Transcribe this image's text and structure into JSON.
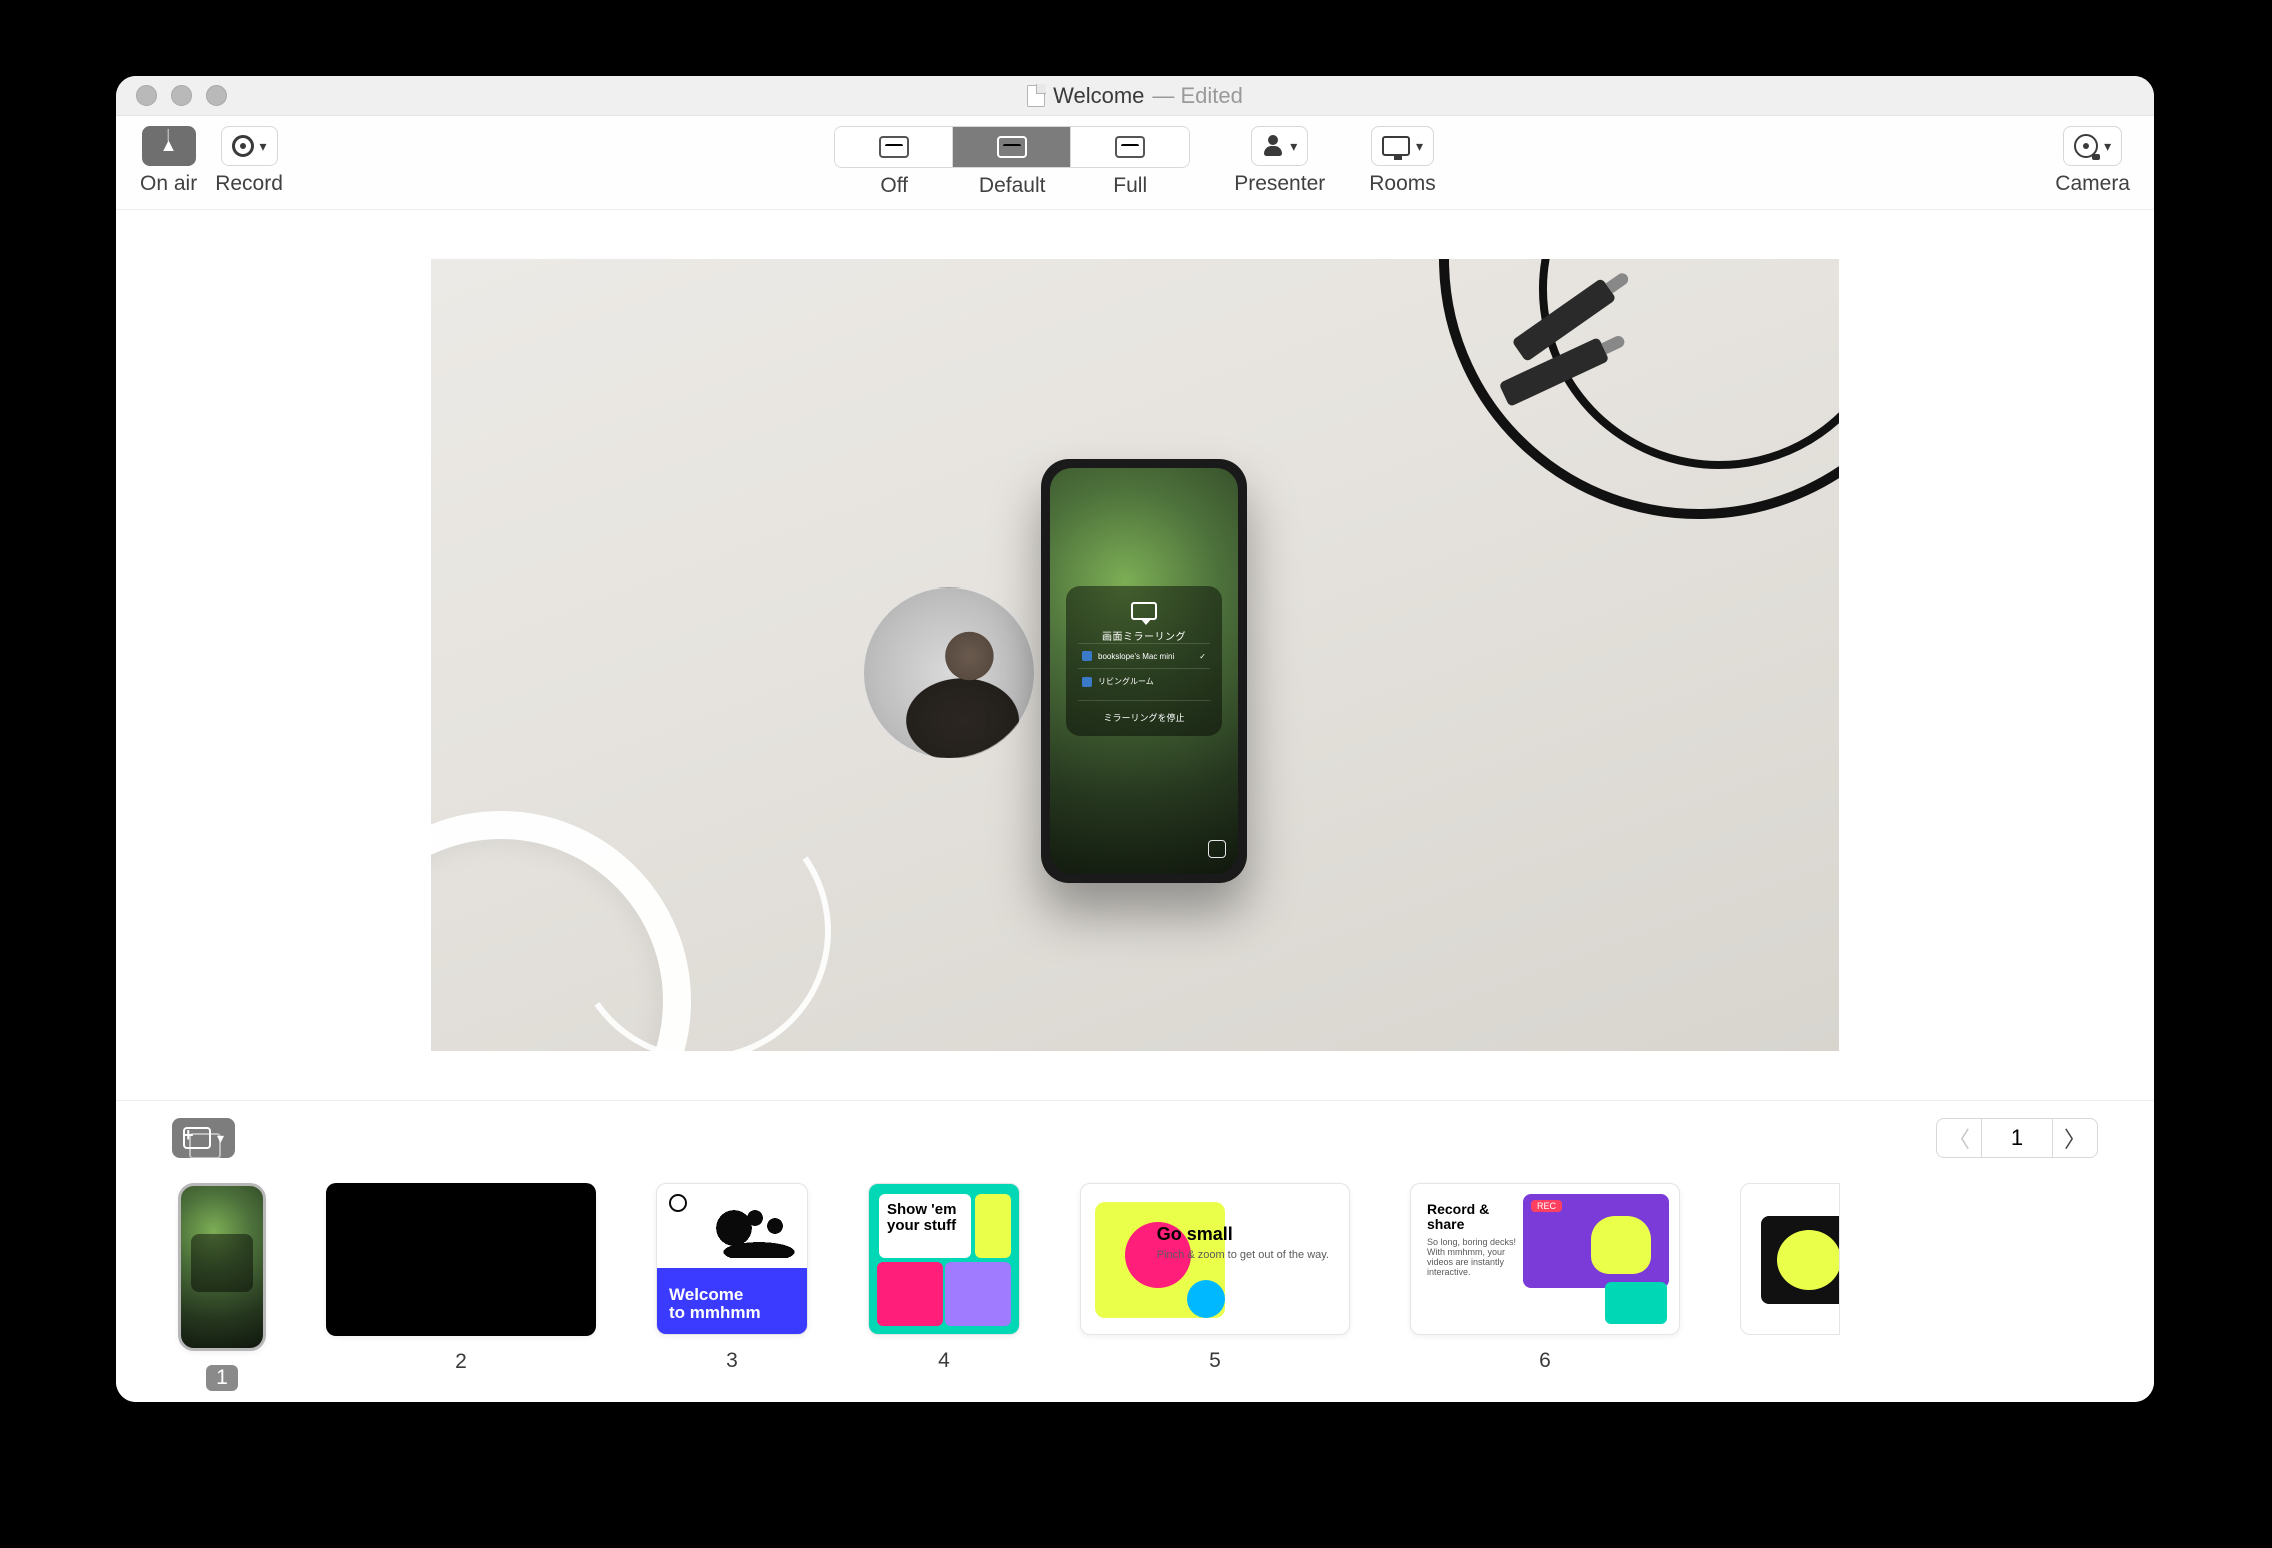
{
  "window": {
    "doc_title": "Welcome",
    "edited_suffix": " — Edited"
  },
  "toolbar": {
    "on_air_label": "On air",
    "record_label": "Record",
    "seg": {
      "off": "Off",
      "default": "Default",
      "full": "Full"
    },
    "presenter_label": "Presenter",
    "rooms_label": "Rooms",
    "camera_label": "Camera"
  },
  "preview": {
    "airplay": {
      "title": "画面ミラーリング",
      "row1": "bookslope's Mac mini",
      "row2": "リビングルーム",
      "stop": "ミラーリングを停止"
    }
  },
  "tray": {
    "current_page": "1",
    "slides": {
      "s1": "1",
      "s2": "2",
      "s3": "3",
      "s4": "4",
      "s5": "5",
      "s6": "6",
      "t3_line1": "Welcome",
      "t3_line2": "to mmhmm",
      "t4_line1": "Show 'em",
      "t4_line2": "your stuff",
      "t5_title": "Go small",
      "t5_sub": "Pinch & zoom to get out of the way.",
      "t6_title": "Record & share",
      "t6_sub": "So long, boring decks! With mmhmm, your videos are instantly interactive."
    }
  }
}
